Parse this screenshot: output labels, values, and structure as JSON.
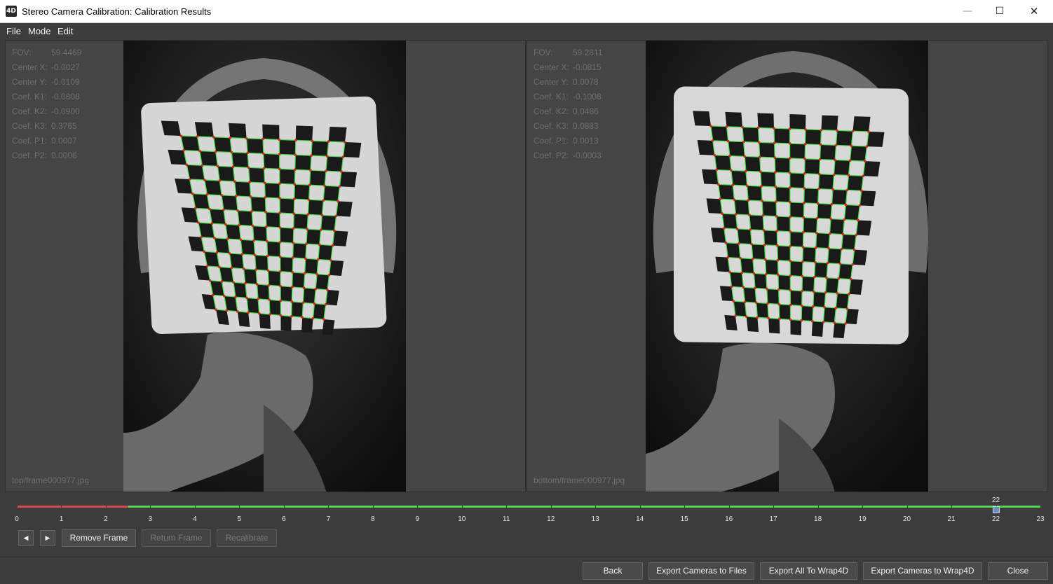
{
  "window": {
    "icon_text": "4D",
    "title": "Stereo Camera Calibration: Calibration Results",
    "minimize_glyph": "—",
    "maximize_glyph": "☐",
    "close_glyph": "✕"
  },
  "menu": [
    "File",
    "Mode",
    "Edit"
  ],
  "left_camera": {
    "params": [
      {
        "label": "FOV:",
        "value": "59.4469"
      },
      {
        "label": "Center X:",
        "value": "-0.0027"
      },
      {
        "label": "Center Y:",
        "value": "-0.0109"
      },
      {
        "label": "Coef. K1:",
        "value": "-0.0808"
      },
      {
        "label": "Coef. K2:",
        "value": "-0.0900"
      },
      {
        "label": "Coef. K3:",
        "value": "0.3765"
      },
      {
        "label": "Coef. P1:",
        "value": "0.0007"
      },
      {
        "label": "Coef. P2:",
        "value": "0.0006"
      }
    ],
    "file": "top/frame000977.jpg"
  },
  "right_camera": {
    "params": [
      {
        "label": "FOV:",
        "value": "59.2811"
      },
      {
        "label": "Center X:",
        "value": "-0.0815"
      },
      {
        "label": "Center Y:",
        "value": "0.0078"
      },
      {
        "label": "Coef. K1:",
        "value": "-0.1008"
      },
      {
        "label": "Coef. K2:",
        "value": "0.0486"
      },
      {
        "label": "Coef. K3:",
        "value": "0.0883"
      },
      {
        "label": "Coef. P1:",
        "value": "0.0013"
      },
      {
        "label": "Coef. P2:",
        "value": "-0.0003"
      }
    ],
    "file": "bottom/frame000977.jpg"
  },
  "timeline": {
    "min": 0,
    "max": 23,
    "ticks": [
      "0",
      "1",
      "2",
      "3",
      "4",
      "5",
      "6",
      "7",
      "8",
      "9",
      "10",
      "11",
      "12",
      "13",
      "14",
      "15",
      "16",
      "17",
      "18",
      "19",
      "20",
      "21",
      "22",
      "23"
    ],
    "current_label": "22",
    "current": 22,
    "rejected_until": 2.5,
    "colors": {
      "accepted": "#52d652",
      "rejected": "#d84848"
    }
  },
  "controls": {
    "prev_glyph": "◀",
    "next_glyph": "▶",
    "remove_frame": "Remove Frame",
    "return_frame": "Return Frame",
    "recalibrate": "Recalibrate"
  },
  "footer": {
    "back": "Back",
    "export_files": "Export Cameras to Files",
    "export_all": "Export All To Wrap4D",
    "export_cameras": "Export Cameras to Wrap4D",
    "close": "Close"
  }
}
